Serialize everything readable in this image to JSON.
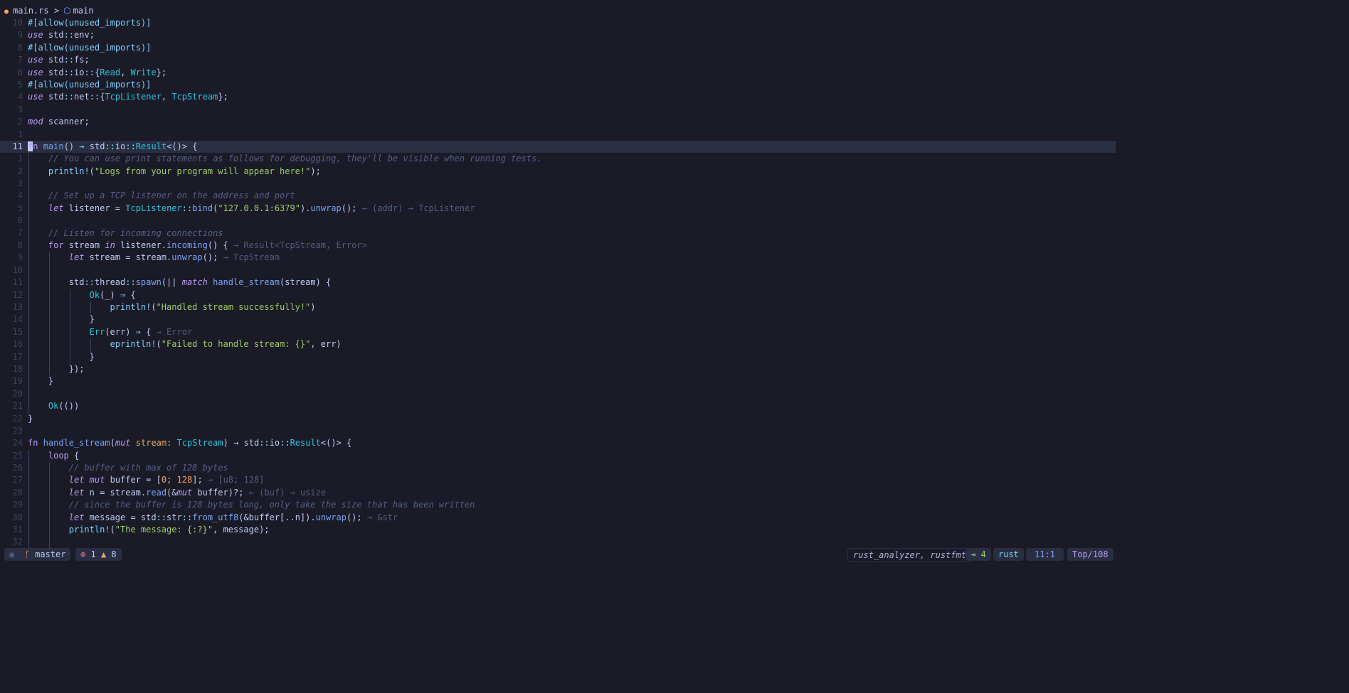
{
  "breadcrumb": {
    "file": "main.rs",
    "separator": ">",
    "symbol": "main"
  },
  "editor": {
    "lines": [
      {
        "n": "10",
        "segs": [
          [
            "attr",
            "#[allow(unused_imports)]"
          ]
        ]
      },
      {
        "n": "9",
        "segs": [
          [
            "kw",
            "use"
          ],
          [
            "p",
            " std"
          ],
          [
            "op",
            "::"
          ],
          [
            "p",
            "env;"
          ]
        ]
      },
      {
        "n": "8",
        "segs": [
          [
            "attr",
            "#[allow(unused_imports)]"
          ]
        ]
      },
      {
        "n": "7",
        "segs": [
          [
            "kw",
            "use"
          ],
          [
            "p",
            " std"
          ],
          [
            "op",
            "::"
          ],
          [
            "p",
            "fs;"
          ]
        ]
      },
      {
        "n": "6",
        "segs": [
          [
            "kw",
            "use"
          ],
          [
            "p",
            " std"
          ],
          [
            "op",
            "::"
          ],
          [
            "p",
            "io"
          ],
          [
            "op",
            "::"
          ],
          [
            "p",
            "{"
          ],
          [
            "ty",
            "Read"
          ],
          [
            "p",
            ", "
          ],
          [
            "ty",
            "Write"
          ],
          [
            "p",
            "};"
          ]
        ]
      },
      {
        "n": "5",
        "segs": [
          [
            "attr",
            "#[allow(unused_imports)]"
          ]
        ]
      },
      {
        "n": "4",
        "segs": [
          [
            "kw",
            "use"
          ],
          [
            "p",
            " std"
          ],
          [
            "op",
            "::"
          ],
          [
            "p",
            "net"
          ],
          [
            "op",
            "::"
          ],
          [
            "p",
            "{"
          ],
          [
            "ty",
            "TcpListener"
          ],
          [
            "p",
            ", "
          ],
          [
            "ty",
            "TcpStream"
          ],
          [
            "p",
            "};"
          ]
        ]
      },
      {
        "n": "3",
        "segs": []
      },
      {
        "n": "2",
        "segs": [
          [
            "kw",
            "mod"
          ],
          [
            "p",
            " scanner;"
          ]
        ]
      },
      {
        "n": "1",
        "segs": []
      },
      {
        "n": "11",
        "current": true,
        "segs": [
          [
            "cur",
            "f"
          ],
          [
            "kwn",
            "n"
          ],
          [
            "p",
            " "
          ],
          [
            "fn",
            "main"
          ],
          [
            "p",
            "() "
          ],
          [
            "op",
            "→"
          ],
          [
            "p",
            " std"
          ],
          [
            "op",
            "::"
          ],
          [
            "p",
            "io"
          ],
          [
            "op",
            "::"
          ],
          [
            "ty",
            "Result"
          ],
          [
            "p",
            "<()> {"
          ]
        ]
      },
      {
        "n": "1",
        "indent": 1,
        "segs": [
          [
            "cm",
            "// You can use print statements as follows for debugging, they'll be visible when running tests."
          ]
        ]
      },
      {
        "n": "2",
        "indent": 1,
        "segs": [
          [
            "mac",
            "println!"
          ],
          [
            "p",
            "("
          ],
          [
            "str",
            "\"Logs from your program will appear here!\""
          ],
          [
            "p",
            ");"
          ]
        ]
      },
      {
        "n": "3",
        "indent": 1,
        "segs": []
      },
      {
        "n": "4",
        "indent": 1,
        "segs": [
          [
            "cm",
            "// Set up a TCP listener on the address and port"
          ]
        ]
      },
      {
        "n": "5",
        "indent": 1,
        "segs": [
          [
            "kw",
            "let"
          ],
          [
            "p",
            " listener = "
          ],
          [
            "ty",
            "TcpListener"
          ],
          [
            "op",
            "::"
          ],
          [
            "fn",
            "bind"
          ],
          [
            "p",
            "("
          ],
          [
            "str",
            "\"127.0.0.1:6379\""
          ],
          [
            "p",
            ")."
          ],
          [
            "fn",
            "unwrap"
          ],
          [
            "p",
            "(); "
          ],
          [
            "hint",
            "← (addr) → TcpListener"
          ]
        ]
      },
      {
        "n": "6",
        "indent": 1,
        "segs": []
      },
      {
        "n": "7",
        "indent": 1,
        "segs": [
          [
            "cm",
            "// Listen for incoming connections"
          ]
        ]
      },
      {
        "n": "8",
        "indent": 1,
        "segs": [
          [
            "kwn",
            "for"
          ],
          [
            "p",
            " stream "
          ],
          [
            "kw",
            "in"
          ],
          [
            "p",
            " listener."
          ],
          [
            "fn",
            "incoming"
          ],
          [
            "p",
            "() { "
          ],
          [
            "hint",
            "→ Result<TcpStream, Error>"
          ]
        ]
      },
      {
        "n": "9",
        "indent": 2,
        "segs": [
          [
            "kw",
            "let"
          ],
          [
            "p",
            " stream = stream."
          ],
          [
            "fn",
            "unwrap"
          ],
          [
            "p",
            "(); "
          ],
          [
            "hint",
            "→ TcpStream"
          ]
        ]
      },
      {
        "n": "10",
        "indent": 2,
        "segs": []
      },
      {
        "n": "11",
        "indent": 2,
        "segs": [
          [
            "p",
            "std"
          ],
          [
            "op",
            "::"
          ],
          [
            "p",
            "thread"
          ],
          [
            "op",
            "::"
          ],
          [
            "fn",
            "spawn"
          ],
          [
            "p",
            "(|| "
          ],
          [
            "kw",
            "match"
          ],
          [
            "p",
            " "
          ],
          [
            "fn",
            "handle_stream"
          ],
          [
            "p",
            "(stream) {"
          ]
        ]
      },
      {
        "n": "12",
        "indent": 3,
        "segs": [
          [
            "ty",
            "Ok"
          ],
          [
            "p",
            "(_) "
          ],
          [
            "op",
            "⇒"
          ],
          [
            "p",
            " {"
          ]
        ]
      },
      {
        "n": "13",
        "indent": 4,
        "segs": [
          [
            "mac",
            "println!"
          ],
          [
            "p",
            "("
          ],
          [
            "str",
            "\"Handled stream successfully!\""
          ],
          [
            "p",
            ")"
          ]
        ]
      },
      {
        "n": "14",
        "indent": 3,
        "segs": [
          [
            "p",
            "}"
          ]
        ]
      },
      {
        "n": "15",
        "indent": 3,
        "segs": [
          [
            "ty",
            "Err"
          ],
          [
            "p",
            "(err) "
          ],
          [
            "op",
            "⇒"
          ],
          [
            "p",
            " { "
          ],
          [
            "hint",
            "→ Error"
          ]
        ]
      },
      {
        "n": "16",
        "indent": 4,
        "segs": [
          [
            "mac",
            "eprintln!"
          ],
          [
            "p",
            "("
          ],
          [
            "str",
            "\"Failed to handle stream: {}\""
          ],
          [
            "p",
            ", err)"
          ]
        ]
      },
      {
        "n": "17",
        "indent": 3,
        "segs": [
          [
            "p",
            "}"
          ]
        ]
      },
      {
        "n": "18",
        "indent": 2,
        "segs": [
          [
            "p",
            "});"
          ]
        ]
      },
      {
        "n": "19",
        "indent": 1,
        "segs": [
          [
            "p",
            "}"
          ]
        ]
      },
      {
        "n": "20",
        "indent": 1,
        "segs": []
      },
      {
        "n": "21",
        "indent": 1,
        "segs": [
          [
            "ty",
            "Ok"
          ],
          [
            "p",
            "(())"
          ]
        ]
      },
      {
        "n": "22",
        "segs": [
          [
            "p",
            "}"
          ]
        ]
      },
      {
        "n": "23",
        "segs": []
      },
      {
        "n": "24",
        "segs": [
          [
            "kwn",
            "fn"
          ],
          [
            "p",
            " "
          ],
          [
            "fn",
            "handle_stream"
          ],
          [
            "p",
            "("
          ],
          [
            "kw",
            "mut"
          ],
          [
            "p",
            " "
          ],
          [
            "prm",
            "stream"
          ],
          [
            "p",
            ": "
          ],
          [
            "ty",
            "TcpStream"
          ],
          [
            "p",
            ") "
          ],
          [
            "op",
            "→"
          ],
          [
            "p",
            " std"
          ],
          [
            "op",
            "::"
          ],
          [
            "p",
            "io"
          ],
          [
            "op",
            "::"
          ],
          [
            "ty",
            "Result"
          ],
          [
            "p",
            "<()> {"
          ]
        ]
      },
      {
        "n": "25",
        "indent": 1,
        "segs": [
          [
            "kwn",
            "loop"
          ],
          [
            "p",
            " {"
          ]
        ]
      },
      {
        "n": "26",
        "indent": 2,
        "segs": [
          [
            "cm",
            "// buffer with max of 128 bytes"
          ]
        ]
      },
      {
        "n": "27",
        "indent": 2,
        "segs": [
          [
            "kw",
            "let"
          ],
          [
            "p",
            " "
          ],
          [
            "kw",
            "mut"
          ],
          [
            "p",
            " buffer = ["
          ],
          [
            "num",
            "0"
          ],
          [
            "p",
            "; "
          ],
          [
            "num",
            "128"
          ],
          [
            "p",
            "]; "
          ],
          [
            "hint",
            "→ [u8; 128]"
          ]
        ]
      },
      {
        "n": "28",
        "indent": 2,
        "segs": [
          [
            "kw",
            "let"
          ],
          [
            "p",
            " n = stream."
          ],
          [
            "fn",
            "read"
          ],
          [
            "p",
            "(&"
          ],
          [
            "kw",
            "mut"
          ],
          [
            "p",
            " buffer)?; "
          ],
          [
            "hint",
            "← (buf) → usize"
          ]
        ]
      },
      {
        "n": "29",
        "indent": 2,
        "segs": [
          [
            "cm",
            "// since the buffer is 128 bytes long, only take the size that has been written"
          ]
        ]
      },
      {
        "n": "30",
        "indent": 2,
        "segs": [
          [
            "kw",
            "let"
          ],
          [
            "p",
            " message = std"
          ],
          [
            "op",
            "::"
          ],
          [
            "p",
            "str"
          ],
          [
            "op",
            "::"
          ],
          [
            "fn",
            "from_utf8"
          ],
          [
            "p",
            "(&buffer[..n])."
          ],
          [
            "fn",
            "unwrap"
          ],
          [
            "p",
            "(); "
          ],
          [
            "hint",
            "→ &str"
          ]
        ]
      },
      {
        "n": "31",
        "indent": 2,
        "segs": [
          [
            "mac",
            "println!"
          ],
          [
            "p",
            "("
          ],
          [
            "str",
            "\"The message: {:?}\""
          ],
          [
            "p",
            ", message);"
          ]
        ]
      },
      {
        "n": "32",
        "indent": 2,
        "segs": []
      }
    ]
  },
  "statusbar": {
    "branch": "master",
    "errors": "1",
    "warnings": "8",
    "lsp": "rust_analyzer, rustfmt",
    "indent": "4",
    "language": "rust",
    "position": "11:1",
    "progress": "Top/108"
  }
}
